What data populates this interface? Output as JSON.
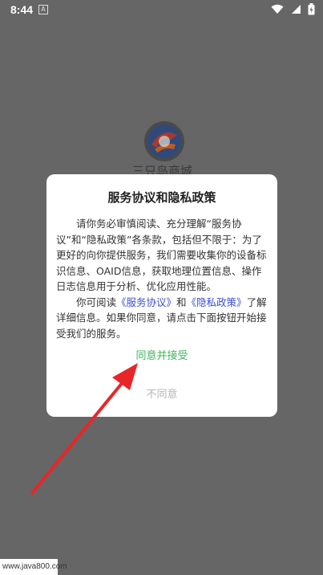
{
  "status_bar": {
    "time": "8:44",
    "notification_icon": "A"
  },
  "background_app": {
    "name": "三只鸟商城",
    "logo_icon": "app-logo"
  },
  "dialog": {
    "title": "服务协议和隐私政策",
    "paragraph1": "请你务必审慎阅读、充分理解“服务协议”和“隐私政策”各条款，包括但不限于：为了更好的向你提供服务，我们需要收集你的设备标识信息、OAID信息，获取地理位置信息、操作日志信息用于分析、优化应用性能。",
    "paragraph2_prefix": "你可阅读",
    "service_link": "《服务协议》",
    "and": "和",
    "privacy_link": "《隐私政策》",
    "paragraph2_suffix": "了解详细信息。如果你同意，请点击下面按钮开始接受我们的服务。",
    "agree_label": "同意并接受",
    "disagree_label": "不同意"
  },
  "colors": {
    "agree": "#3cb55c",
    "link": "#3a4fd0",
    "arrow": "#e8262a",
    "overlay": "#666666"
  },
  "watermark": "www.java800.com"
}
